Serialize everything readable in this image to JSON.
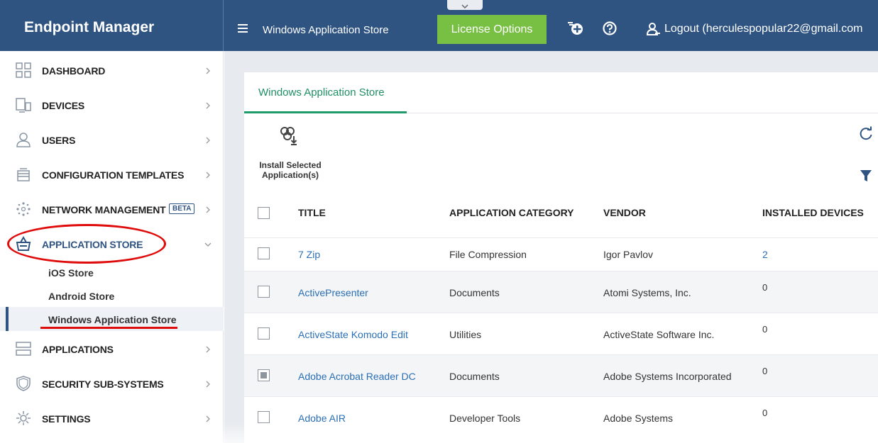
{
  "app": {
    "brand": "Endpoint Manager",
    "page_title": "Windows Application Store",
    "license_button": "License Options",
    "logout_label": "Logout (herculespopular22@gmail.com"
  },
  "sidebar": {
    "items": [
      {
        "label": "DASHBOARD",
        "icon": "dashboard-icon"
      },
      {
        "label": "DEVICES",
        "icon": "devices-icon"
      },
      {
        "label": "USERS",
        "icon": "users-icon"
      },
      {
        "label": "CONFIGURATION TEMPLATES",
        "icon": "templates-icon"
      },
      {
        "label": "NETWORK MANAGEMENT",
        "icon": "network-icon",
        "badge": "BETA"
      },
      {
        "label": "APPLICATION STORE",
        "icon": "store-icon"
      },
      {
        "label": "APPLICATIONS",
        "icon": "applications-icon"
      },
      {
        "label": "SECURITY SUB-SYSTEMS",
        "icon": "shield-icon"
      },
      {
        "label": "SETTINGS",
        "icon": "gear-icon"
      }
    ],
    "store_sub": [
      "iOS Store",
      "Android Store",
      "Windows Application Store"
    ]
  },
  "main": {
    "tab": "Windows Application Store",
    "install_label_1": "Install Selected",
    "install_label_2": "Application(s)",
    "columns": [
      "TITLE",
      "APPLICATION CATEGORY",
      "VENDOR",
      "INSTALLED DEVICES"
    ],
    "rows": [
      {
        "title": "7 Zip",
        "category": "File Compression",
        "vendor": "Igor Pavlov",
        "installed": "2",
        "checked": false
      },
      {
        "title": "ActivePresenter",
        "category": "Documents",
        "vendor": "Atomi Systems, Inc.",
        "installed": "0",
        "checked": false
      },
      {
        "title": "ActiveState Komodo Edit",
        "category": "Utilities",
        "vendor": "ActiveState Software Inc.",
        "installed": "0",
        "checked": false
      },
      {
        "title": "Adobe Acrobat Reader DC",
        "category": "Documents",
        "vendor": "Adobe Systems Incorporated",
        "installed": "0",
        "checked": true
      },
      {
        "title": "Adobe AIR",
        "category": "Developer Tools",
        "vendor": "Adobe Systems",
        "installed": "0",
        "checked": false
      }
    ]
  },
  "colors": {
    "header": "#2f5482",
    "license_button": "#78c043",
    "tab_accent": "#1f9b6b",
    "link": "#2a6fb5",
    "annotation_red": "#e00b0b"
  }
}
